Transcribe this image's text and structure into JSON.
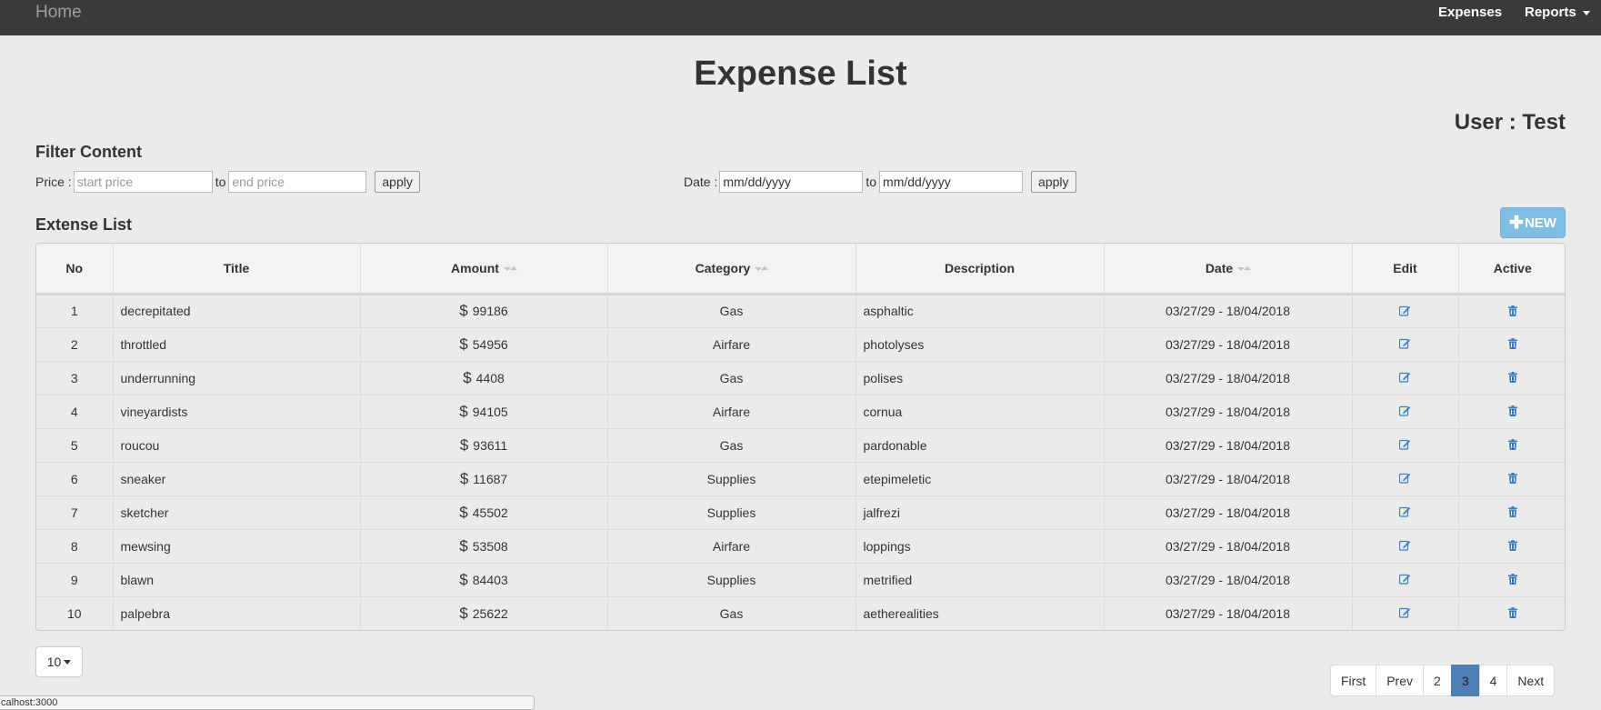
{
  "nav": {
    "home_label": "Home",
    "expenses_label": "Expenses",
    "reports_label": "Reports"
  },
  "page": {
    "title": "Expense List",
    "user_label": "User : Test"
  },
  "filter": {
    "heading": "Filter Content",
    "price_label": "Price :",
    "price_start_placeholder": "start price",
    "price_to": "to",
    "price_end_placeholder": "end price",
    "price_apply": "apply",
    "date_label": "Date :",
    "date_start_value": "mm/dd/yyyy",
    "date_to": "to",
    "date_end_value": "mm/dd/yyyy",
    "date_apply": "apply"
  },
  "list": {
    "heading": "Extense List",
    "new_button": "NEW",
    "columns": [
      "No",
      "Title",
      "Amount",
      "Category",
      "Description",
      "Date",
      "Edit",
      "Active"
    ],
    "sortable_columns": [
      "Amount",
      "Category",
      "Date"
    ],
    "currency_symbol": "$",
    "rows": [
      {
        "no": "1",
        "title": "decrepitated",
        "amount": "99186",
        "category": "Gas",
        "description": "asphaltic",
        "date": "03/27/29 - 18/04/2018"
      },
      {
        "no": "2",
        "title": "throttled",
        "amount": "54956",
        "category": "Airfare",
        "description": "photolyses",
        "date": "03/27/29 - 18/04/2018"
      },
      {
        "no": "3",
        "title": "underrunning",
        "amount": "4408",
        "category": "Gas",
        "description": "polises",
        "date": "03/27/29 - 18/04/2018"
      },
      {
        "no": "4",
        "title": "vineyardists",
        "amount": "94105",
        "category": "Airfare",
        "description": "cornua",
        "date": "03/27/29 - 18/04/2018"
      },
      {
        "no": "5",
        "title": "roucou",
        "amount": "93611",
        "category": "Gas",
        "description": "pardonable",
        "date": "03/27/29 - 18/04/2018"
      },
      {
        "no": "6",
        "title": "sneaker",
        "amount": "11687",
        "category": "Supplies",
        "description": "etepimeletic",
        "date": "03/27/29 - 18/04/2018"
      },
      {
        "no": "7",
        "title": "sketcher",
        "amount": "45502",
        "category": "Supplies",
        "description": "jalfrezi",
        "date": "03/27/29 - 18/04/2018"
      },
      {
        "no": "8",
        "title": "mewsing",
        "amount": "53508",
        "category": "Airfare",
        "description": "loppings",
        "date": "03/27/29 - 18/04/2018"
      },
      {
        "no": "9",
        "title": "blawn",
        "amount": "84403",
        "category": "Supplies",
        "description": "metrified",
        "date": "03/27/29 - 18/04/2018"
      },
      {
        "no": "10",
        "title": "palpebra",
        "amount": "25622",
        "category": "Gas",
        "description": "aetherealities",
        "date": "03/27/29 - 18/04/2018"
      }
    ]
  },
  "pagination": {
    "page_size": "10",
    "buttons": [
      "First",
      "Prev",
      "2",
      "3",
      "4",
      "Next"
    ],
    "active": "3"
  },
  "status_bar": {
    "text": "calhost:3000"
  },
  "colors": {
    "navbar": "#3a3a3a",
    "new_button": "#7fbde2",
    "icon_blue": "#3a7bc8",
    "active_page": "#4f7fb7"
  }
}
